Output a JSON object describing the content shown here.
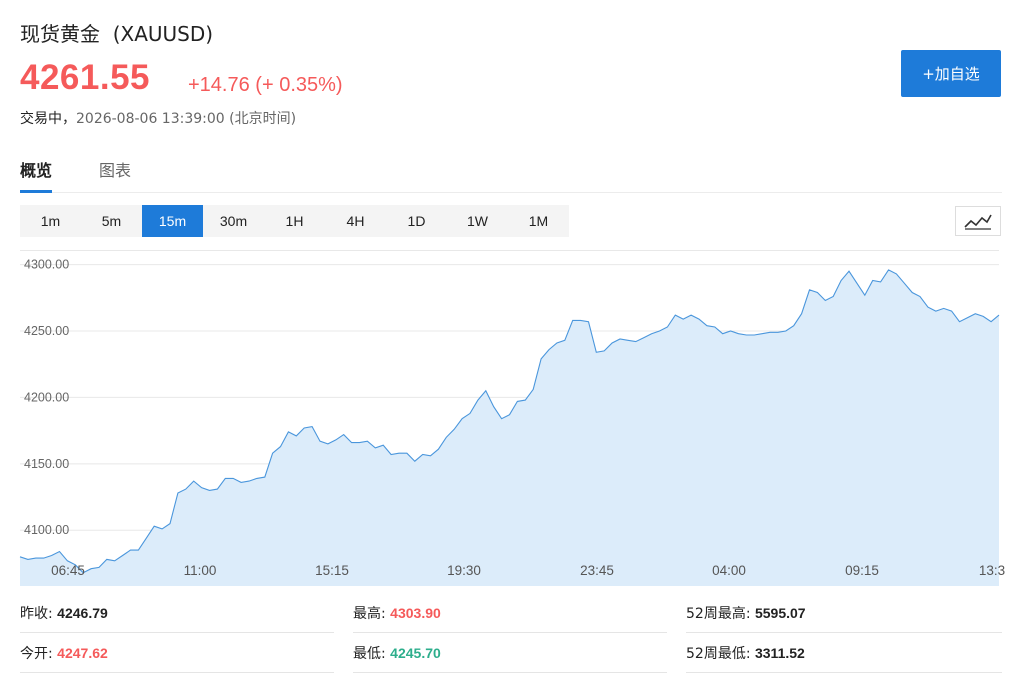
{
  "header": {
    "name": "现货黄金",
    "symbol": "(XAUUSD)",
    "price": "4261.55",
    "change": "+14.76",
    "change_pct": "(+ 0.35%)",
    "status_label": "交易中，",
    "timestamp": "2026-08-06 13:39:00",
    "timezone": "(北京时间)",
    "add_button": "+加自选"
  },
  "tabs": [
    {
      "label": "概览",
      "active": true
    },
    {
      "label": "图表",
      "active": false
    }
  ],
  "periods": [
    {
      "label": "1m",
      "active": false
    },
    {
      "label": "5m",
      "active": false
    },
    {
      "label": "15m",
      "active": true
    },
    {
      "label": "30m",
      "active": false
    },
    {
      "label": "1H",
      "active": false
    },
    {
      "label": "4H",
      "active": false
    },
    {
      "label": "1D",
      "active": false
    },
    {
      "label": "1W",
      "active": false
    },
    {
      "label": "1M",
      "active": false
    }
  ],
  "chart_type_icon": "line-chart-icon",
  "colors": {
    "up": "#f55a5a",
    "down": "#2dae8c",
    "accent": "#1e7bd9",
    "line": "#4a96dc",
    "fill": "#dcecfa"
  },
  "chart_data": {
    "type": "area",
    "title": "",
    "xlabel": "",
    "ylabel": "",
    "ylim": [
      4058,
      4311
    ],
    "yticks": [
      "4300.00",
      "4250.00",
      "4200.00",
      "4150.00",
      "4100.00"
    ],
    "xticks": [
      "06:45",
      "11:00",
      "15:15",
      "19:30",
      "23:45",
      "04:00",
      "09:15",
      "13:3"
    ],
    "grid": true,
    "series": [
      {
        "values": [
          4080,
          4078,
          4079,
          4079,
          4081,
          4084,
          4077,
          4074,
          4068,
          4071,
          4072,
          4078,
          4077,
          4081,
          4085,
          4085,
          4094,
          4103,
          4101,
          4105,
          4128,
          4131,
          4137,
          4132,
          4130,
          4131,
          4139,
          4139,
          4136,
          4137,
          4139,
          4140,
          4158,
          4163,
          4174,
          4171,
          4177,
          4178,
          4167,
          4165,
          4168,
          4172,
          4166,
          4166,
          4167,
          4162,
          4164,
          4157,
          4158,
          4158,
          4152,
          4157,
          4156,
          4161,
          4170,
          4176,
          4184,
          4188,
          4198,
          4205,
          4193,
          4184,
          4187,
          4197,
          4198,
          4206,
          4229,
          4236,
          4241,
          4243,
          4258,
          4258,
          4257,
          4234,
          4235,
          4241,
          4244,
          4243,
          4242,
          4245,
          4248,
          4250,
          4253,
          4262,
          4259,
          4262,
          4259,
          4254,
          4253,
          4248,
          4250,
          4248,
          4247,
          4247,
          4248,
          4249,
          4249,
          4250,
          4254,
          4263,
          4281,
          4279,
          4273,
          4276,
          4288,
          4295,
          4286,
          4277,
          4288,
          4287,
          4296,
          4293,
          4286,
          4279,
          4276,
          4268,
          4265,
          4267,
          4265,
          4257,
          4260,
          4263,
          4261,
          4257,
          4262
        ]
      }
    ]
  },
  "stats": [
    {
      "label": "昨收:",
      "value": "4246.79",
      "tone": "neutral"
    },
    {
      "label": "最高:",
      "value": "4303.90",
      "tone": "up"
    },
    {
      "label": "52周最高:",
      "value": "5595.07",
      "tone": "neutral"
    },
    {
      "label": "今开:",
      "value": "4247.62",
      "tone": "up"
    },
    {
      "label": "最低:",
      "value": "4245.70",
      "tone": "down"
    },
    {
      "label": "52周最低:",
      "value": "3311.52",
      "tone": "neutral"
    }
  ]
}
